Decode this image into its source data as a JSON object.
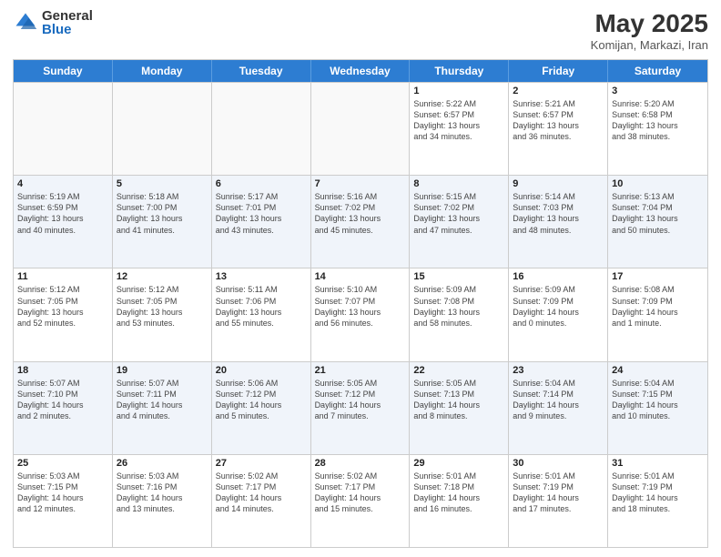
{
  "logo": {
    "general": "General",
    "blue": "Blue"
  },
  "title": {
    "month": "May 2025",
    "location": "Komijan, Markazi, Iran"
  },
  "weekdays": [
    "Sunday",
    "Monday",
    "Tuesday",
    "Wednesday",
    "Thursday",
    "Friday",
    "Saturday"
  ],
  "rows": [
    [
      {
        "day": "",
        "info": ""
      },
      {
        "day": "",
        "info": ""
      },
      {
        "day": "",
        "info": ""
      },
      {
        "day": "",
        "info": ""
      },
      {
        "day": "1",
        "info": "Sunrise: 5:22 AM\nSunset: 6:57 PM\nDaylight: 13 hours\nand 34 minutes."
      },
      {
        "day": "2",
        "info": "Sunrise: 5:21 AM\nSunset: 6:57 PM\nDaylight: 13 hours\nand 36 minutes."
      },
      {
        "day": "3",
        "info": "Sunrise: 5:20 AM\nSunset: 6:58 PM\nDaylight: 13 hours\nand 38 minutes."
      }
    ],
    [
      {
        "day": "4",
        "info": "Sunrise: 5:19 AM\nSunset: 6:59 PM\nDaylight: 13 hours\nand 40 minutes."
      },
      {
        "day": "5",
        "info": "Sunrise: 5:18 AM\nSunset: 7:00 PM\nDaylight: 13 hours\nand 41 minutes."
      },
      {
        "day": "6",
        "info": "Sunrise: 5:17 AM\nSunset: 7:01 PM\nDaylight: 13 hours\nand 43 minutes."
      },
      {
        "day": "7",
        "info": "Sunrise: 5:16 AM\nSunset: 7:02 PM\nDaylight: 13 hours\nand 45 minutes."
      },
      {
        "day": "8",
        "info": "Sunrise: 5:15 AM\nSunset: 7:02 PM\nDaylight: 13 hours\nand 47 minutes."
      },
      {
        "day": "9",
        "info": "Sunrise: 5:14 AM\nSunset: 7:03 PM\nDaylight: 13 hours\nand 48 minutes."
      },
      {
        "day": "10",
        "info": "Sunrise: 5:13 AM\nSunset: 7:04 PM\nDaylight: 13 hours\nand 50 minutes."
      }
    ],
    [
      {
        "day": "11",
        "info": "Sunrise: 5:12 AM\nSunset: 7:05 PM\nDaylight: 13 hours\nand 52 minutes."
      },
      {
        "day": "12",
        "info": "Sunrise: 5:12 AM\nSunset: 7:05 PM\nDaylight: 13 hours\nand 53 minutes."
      },
      {
        "day": "13",
        "info": "Sunrise: 5:11 AM\nSunset: 7:06 PM\nDaylight: 13 hours\nand 55 minutes."
      },
      {
        "day": "14",
        "info": "Sunrise: 5:10 AM\nSunset: 7:07 PM\nDaylight: 13 hours\nand 56 minutes."
      },
      {
        "day": "15",
        "info": "Sunrise: 5:09 AM\nSunset: 7:08 PM\nDaylight: 13 hours\nand 58 minutes."
      },
      {
        "day": "16",
        "info": "Sunrise: 5:09 AM\nSunset: 7:09 PM\nDaylight: 14 hours\nand 0 minutes."
      },
      {
        "day": "17",
        "info": "Sunrise: 5:08 AM\nSunset: 7:09 PM\nDaylight: 14 hours\nand 1 minute."
      }
    ],
    [
      {
        "day": "18",
        "info": "Sunrise: 5:07 AM\nSunset: 7:10 PM\nDaylight: 14 hours\nand 2 minutes."
      },
      {
        "day": "19",
        "info": "Sunrise: 5:07 AM\nSunset: 7:11 PM\nDaylight: 14 hours\nand 4 minutes."
      },
      {
        "day": "20",
        "info": "Sunrise: 5:06 AM\nSunset: 7:12 PM\nDaylight: 14 hours\nand 5 minutes."
      },
      {
        "day": "21",
        "info": "Sunrise: 5:05 AM\nSunset: 7:12 PM\nDaylight: 14 hours\nand 7 minutes."
      },
      {
        "day": "22",
        "info": "Sunrise: 5:05 AM\nSunset: 7:13 PM\nDaylight: 14 hours\nand 8 minutes."
      },
      {
        "day": "23",
        "info": "Sunrise: 5:04 AM\nSunset: 7:14 PM\nDaylight: 14 hours\nand 9 minutes."
      },
      {
        "day": "24",
        "info": "Sunrise: 5:04 AM\nSunset: 7:15 PM\nDaylight: 14 hours\nand 10 minutes."
      }
    ],
    [
      {
        "day": "25",
        "info": "Sunrise: 5:03 AM\nSunset: 7:15 PM\nDaylight: 14 hours\nand 12 minutes."
      },
      {
        "day": "26",
        "info": "Sunrise: 5:03 AM\nSunset: 7:16 PM\nDaylight: 14 hours\nand 13 minutes."
      },
      {
        "day": "27",
        "info": "Sunrise: 5:02 AM\nSunset: 7:17 PM\nDaylight: 14 hours\nand 14 minutes."
      },
      {
        "day": "28",
        "info": "Sunrise: 5:02 AM\nSunset: 7:17 PM\nDaylight: 14 hours\nand 15 minutes."
      },
      {
        "day": "29",
        "info": "Sunrise: 5:01 AM\nSunset: 7:18 PM\nDaylight: 14 hours\nand 16 minutes."
      },
      {
        "day": "30",
        "info": "Sunrise: 5:01 AM\nSunset: 7:19 PM\nDaylight: 14 hours\nand 17 minutes."
      },
      {
        "day": "31",
        "info": "Sunrise: 5:01 AM\nSunset: 7:19 PM\nDaylight: 14 hours\nand 18 minutes."
      }
    ]
  ]
}
